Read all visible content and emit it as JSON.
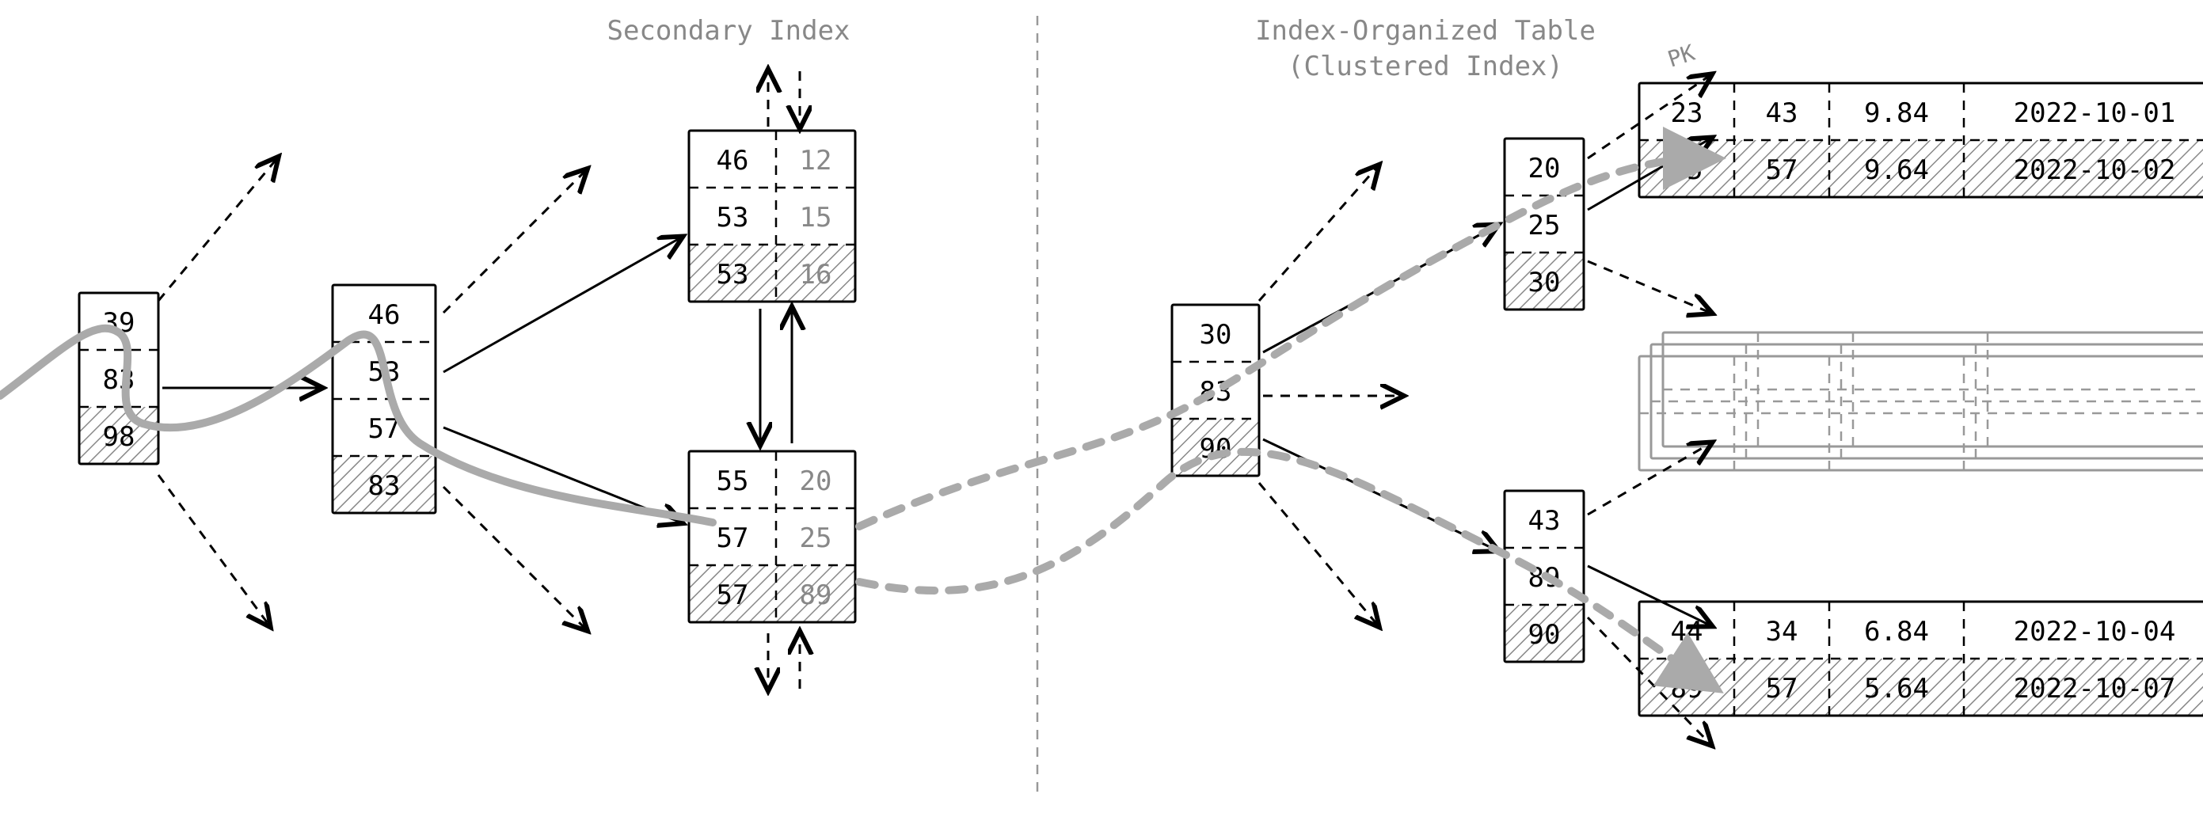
{
  "titles": {
    "left": "Secondary Index",
    "right_top": "Index-Organized Table",
    "right_bottom": "(Clustered Index)",
    "pk": "PK"
  },
  "secondary": {
    "level0": [
      "39",
      "83",
      "98"
    ],
    "level1": [
      "46",
      "53",
      "57",
      "83"
    ],
    "leaf_top": [
      {
        "k": "46",
        "v": "12"
      },
      {
        "k": "53",
        "v": "15"
      },
      {
        "k": "53",
        "v": "16"
      }
    ],
    "leaf_bot": [
      {
        "k": "55",
        "v": "20"
      },
      {
        "k": "57",
        "v": "25"
      },
      {
        "k": "57",
        "v": "89"
      }
    ]
  },
  "clustered": {
    "level0": [
      "30",
      "83",
      "90"
    ],
    "leaf_top": [
      "20",
      "25",
      "30"
    ],
    "leaf_bot": [
      "43",
      "89",
      "90"
    ]
  },
  "rows": {
    "top": [
      [
        "23",
        "43",
        "9.84",
        "2022-10-01"
      ],
      [
        "25",
        "57",
        "9.64",
        "2022-10-02"
      ]
    ],
    "bot": [
      [
        "44",
        "34",
        "6.84",
        "2022-10-04"
      ],
      [
        "89",
        "57",
        "5.64",
        "2022-10-07"
      ]
    ]
  },
  "row_widths": [
    120,
    120,
    170,
    330
  ]
}
